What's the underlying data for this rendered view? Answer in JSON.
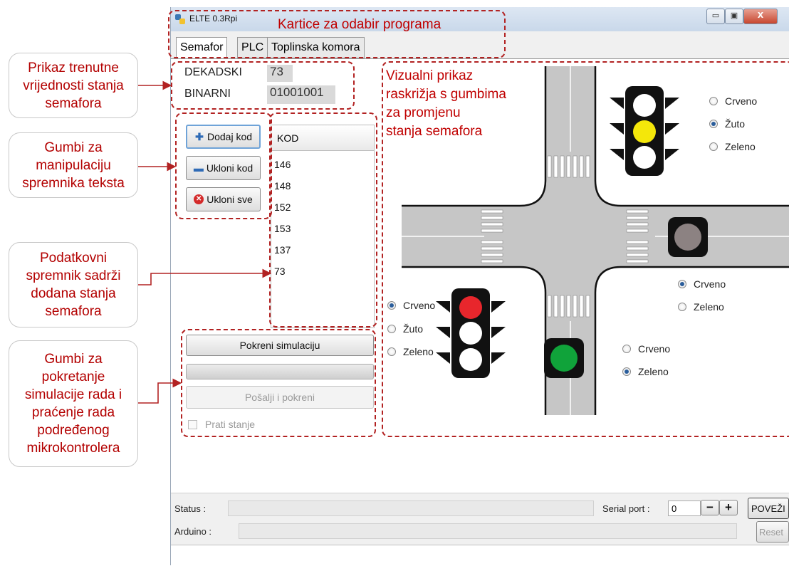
{
  "window": {
    "title": "ELTE 0.3Rpi",
    "min_glyph": "▭",
    "max_glyph": "▣",
    "close_glyph": "X"
  },
  "tabs": [
    {
      "label": "Semafor",
      "active": true
    },
    {
      "label": "PLC"
    },
    {
      "label": "Toplinska komora"
    }
  ],
  "state": {
    "decimal_label": "DEKADSKI",
    "decimal_value": "73",
    "binary_label": "BINARNI",
    "binary_value": "01001001"
  },
  "buttons": {
    "add": "Dodaj kod",
    "remove": "Ukloni kod",
    "remove_all": "Ukloni sve"
  },
  "code_list": {
    "header": "KOD",
    "items": [
      "146",
      "148",
      "152",
      "153",
      "137",
      "73"
    ]
  },
  "simulation": {
    "start_label": "Pokreni simulaciju",
    "progress": 0,
    "send_label": "Pošalji i pokreni",
    "monitor_label": "Prati stanje",
    "monitor_checked": false
  },
  "lights": {
    "north": {
      "options": [
        "Crveno",
        "Žuto",
        "Zeleno"
      ],
      "selected": "Žuto"
    },
    "east": {
      "options": [
        "Crveno",
        "Zeleno"
      ],
      "selected": "Crveno"
    },
    "west": {
      "options": [
        "Crveno",
        "Žuto",
        "Zeleno"
      ],
      "selected": "Crveno"
    },
    "south": {
      "options": [
        "Crveno",
        "Zeleno"
      ],
      "selected": "Zeleno"
    }
  },
  "statusbar": {
    "status_label": "Status :",
    "serial_label": "Serial port :",
    "serial_value": "0",
    "minus": "−",
    "plus": "+",
    "connect_label": "POVEŽI",
    "arduino_label": "Arduino :",
    "reset_label": "Reset"
  },
  "annotations": {
    "tabs_note": "Kartice za odabir programa",
    "state_note": "Prikaz trenutne\nvrijednosti stanja\nsemafora",
    "buttons_note": "Gumbi za\nmanipulaciju\nspremnika teksta",
    "list_note": "Podatkovni\nspremnik sadrži\ndodana stanja\nsemafora",
    "sim_note": "Gumbi za\npokretanje\nsimulacije rada i\npraćenje rada\npodređenog\nmikrokontrolera",
    "visual_note": "Vizualni prikaz\nraskrižja s gumbima\nza promjenu\nstanja semafora"
  },
  "colors": {
    "annotation": "#c00000",
    "red_light": "#e8262c",
    "yellow_light": "#f4e70a",
    "green_light": "#10a33a",
    "off_light": "#ffffff",
    "off_grey": "#8c8282"
  }
}
